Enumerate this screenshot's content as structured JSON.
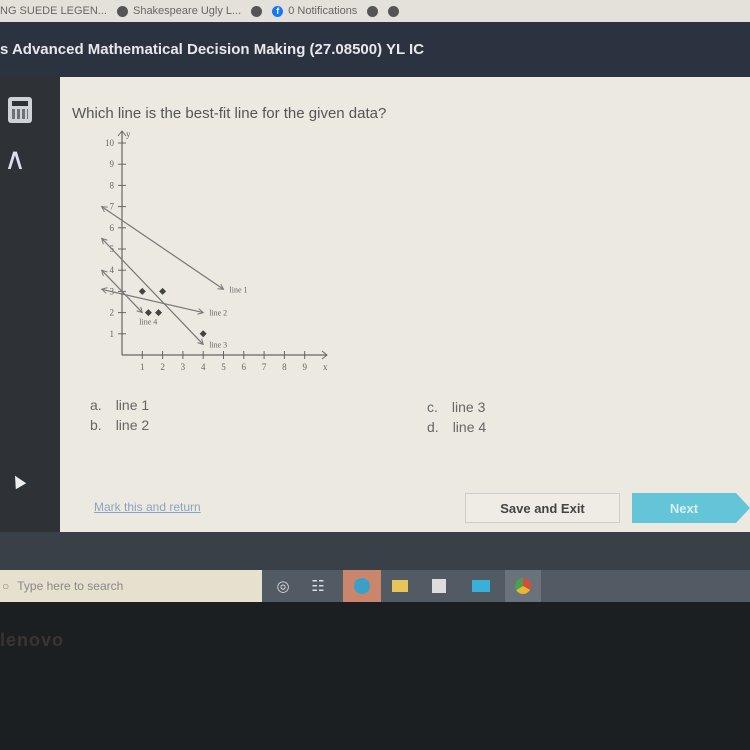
{
  "bookmarks": [
    {
      "label": "NG SUEDE LEGEN...",
      "icon": "globe-icon"
    },
    {
      "label": "Shakespeare Ugly L...",
      "icon": "globe-icon"
    },
    {
      "label": "",
      "icon": "globe-icon"
    },
    {
      "label": "0 Notifications",
      "icon": "facebook-icon"
    },
    {
      "label": "",
      "icon": "globe-icon"
    },
    {
      "label": "",
      "icon": "globe-icon"
    }
  ],
  "header": {
    "title": "s Advanced Mathematical Decision Making (27.08500) YL IC"
  },
  "sidebar": {
    "calculator_icon": "calculator-icon",
    "collapse_icon": "chevron-up-icon"
  },
  "question": {
    "text": "Which line is the best-fit line for the given data?"
  },
  "answers": [
    {
      "letter": "a.",
      "label": "line 1"
    },
    {
      "letter": "b.",
      "label": "line 2"
    },
    {
      "letter": "c.",
      "label": "line 3"
    },
    {
      "letter": "d.",
      "label": "line 4"
    }
  ],
  "footer": {
    "mark_link": "Mark this and return",
    "save_button": "Save and Exit",
    "next_button": "Next"
  },
  "taskbar": {
    "search_placeholder": "Type here to search",
    "apps": [
      "cortana-icon",
      "task-view-icon",
      "edge-icon",
      "file-explorer-icon",
      "store-icon",
      "mail-icon",
      "chrome-icon"
    ]
  },
  "laptop_brand": "lenovo",
  "chart_data": {
    "type": "scatter",
    "title": "",
    "xlabel": "x",
    "ylabel": "y",
    "xlim": [
      0,
      10
    ],
    "ylim": [
      0,
      10
    ],
    "x_ticks": [
      1,
      2,
      3,
      4,
      5,
      6,
      7,
      8,
      9
    ],
    "y_ticks": [
      1,
      2,
      3,
      4,
      5,
      6,
      7,
      8,
      9,
      10
    ],
    "points": [
      {
        "x": 1,
        "y": 3
      },
      {
        "x": 2,
        "y": 3
      },
      {
        "x": 1.3,
        "y": 2
      },
      {
        "x": 1.8,
        "y": 2
      },
      {
        "x": 4,
        "y": 1
      }
    ],
    "lines": [
      {
        "name": "line 1",
        "from": [
          -1,
          7
        ],
        "to": [
          5,
          3.1
        ]
      },
      {
        "name": "line 2",
        "from": [
          -1,
          3.1
        ],
        "to": [
          4,
          2
        ]
      },
      {
        "name": "line 3",
        "from": [
          -1,
          5.5
        ],
        "to": [
          4,
          0.5
        ]
      },
      {
        "name": "line 4",
        "from": [
          -1,
          4
        ],
        "to": [
          1,
          2
        ]
      }
    ]
  }
}
